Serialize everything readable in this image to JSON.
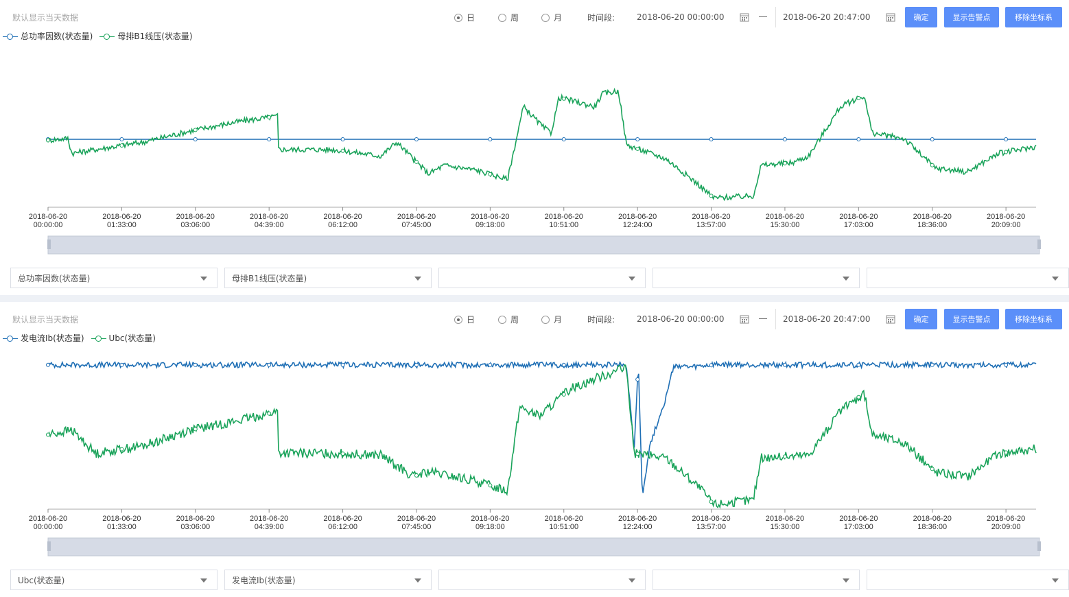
{
  "common": {
    "hint": "默认显示当天数据",
    "radio_day": "日",
    "radio_week": "周",
    "radio_month": "月",
    "time_label": "时间段:",
    "start_date": "2018-06-20 00:00:00",
    "end_date": "2018-06-20 20:47:00",
    "confirm_btn": "确定",
    "alarm_btn": "显示告警点",
    "remove_btn": "移除坐标系",
    "x_ticks_date": "2018-06-20",
    "x_ticks_time": [
      "00:00:00",
      "01:33:00",
      "03:06:00",
      "04:39:00",
      "06:12:00",
      "07:45:00",
      "09:18:00",
      "10:51:00",
      "12:24:00",
      "13:57:00",
      "15:30:00",
      "17:03:00",
      "18:36:00",
      "20:09:00"
    ]
  },
  "panel1": {
    "selects": [
      "总功率因数(状态量)",
      "母排B1线压(状态量)",
      "",
      "",
      ""
    ]
  },
  "panel2": {
    "selects": [
      "Ubc(状态量)",
      "发电流Ib(状态量)",
      "",
      "",
      ""
    ]
  },
  "colors": {
    "blue": "#1f6fb5",
    "green": "#1aa35a",
    "button": "#5b8ff9"
  },
  "chart_data": [
    {
      "type": "line",
      "x_unit": "time (HH:MM), 2018-06-20",
      "x_range": [
        "00:00",
        "20:47"
      ],
      "y_axis_labels": "none",
      "series": [
        {
          "name": "总功率因数(状态量)",
          "color": "#1f6fb5",
          "x": [
            "00:00",
            "20:47"
          ],
          "y": [
            0.73,
            0.73
          ]
        },
        {
          "name": "母排B1线压(状态量)",
          "color": "#1aa35a",
          "x": [
            "00:00",
            "00:25",
            "00:30",
            "02:00",
            "03:00",
            "04:00",
            "04:50",
            "04:51",
            "06:00",
            "07:00",
            "07:20",
            "08:00",
            "08:20",
            "09:00",
            "09:40",
            "10:00",
            "10:25",
            "10:35",
            "10:45",
            "11:30",
            "11:40",
            "12:00",
            "12:10",
            "12:20",
            "13:00",
            "13:40",
            "14:00",
            "14:50",
            "15:00",
            "15:40",
            "16:00",
            "16:40",
            "17:10",
            "17:20",
            "17:30",
            "18:00",
            "18:40",
            "19:20",
            "20:00",
            "20:47"
          ],
          "y": [
            0.72,
            0.74,
            0.58,
            0.7,
            0.82,
            0.92,
            0.98,
            0.62,
            0.62,
            0.55,
            0.7,
            0.36,
            0.45,
            0.4,
            0.3,
            1.08,
            0.86,
            0.8,
            1.18,
            1.08,
            1.22,
            1.25,
            0.67,
            0.64,
            0.52,
            0.25,
            0.1,
            0.12,
            0.45,
            0.48,
            0.55,
            1.08,
            1.2,
            0.8,
            0.78,
            0.74,
            0.42,
            0.38,
            0.58,
            0.65
          ]
        }
      ]
    },
    {
      "type": "line",
      "x_unit": "time (HH:MM), 2018-06-20",
      "x_range": [
        "00:00",
        "20:47"
      ],
      "y_axis_labels": "none",
      "series": [
        {
          "name": "发电流Ib(状态量)",
          "color": "#1f6fb5",
          "x": [
            "00:00",
            "12:00",
            "12:10",
            "12:20",
            "12:25",
            "12:30",
            "12:40",
            "13:00",
            "13:10",
            "13:30",
            "14:00",
            "20:47"
          ],
          "y": [
            1.55,
            1.55,
            1.55,
            0.65,
            1.58,
            0.15,
            0.7,
            1.2,
            1.55,
            1.52,
            1.55,
            1.55
          ]
        },
        {
          "name": "Ubc(状态量)",
          "color": "#1aa35a",
          "x": [
            "00:00",
            "00:30",
            "01:00",
            "02:00",
            "03:00",
            "04:00",
            "04:50",
            "04:51",
            "06:00",
            "07:00",
            "07:40",
            "08:00",
            "09:00",
            "09:40",
            "09:55",
            "10:20",
            "11:00",
            "11:30",
            "12:00",
            "12:10",
            "12:20",
            "13:00",
            "13:40",
            "14:00",
            "14:50",
            "15:00",
            "16:00",
            "16:40",
            "17:10",
            "17:20",
            "18:00",
            "18:40",
            "19:20",
            "20:00",
            "20:47"
          ],
          "y": [
            0.8,
            0.85,
            0.6,
            0.68,
            0.85,
            0.95,
            1.05,
            0.6,
            0.6,
            0.58,
            0.35,
            0.4,
            0.3,
            0.2,
            1.1,
            1.0,
            1.3,
            1.4,
            1.5,
            1.5,
            0.6,
            0.55,
            0.25,
            0.05,
            0.1,
            0.55,
            0.58,
            1.05,
            1.25,
            0.8,
            0.72,
            0.4,
            0.35,
            0.6,
            0.65
          ]
        }
      ]
    }
  ]
}
